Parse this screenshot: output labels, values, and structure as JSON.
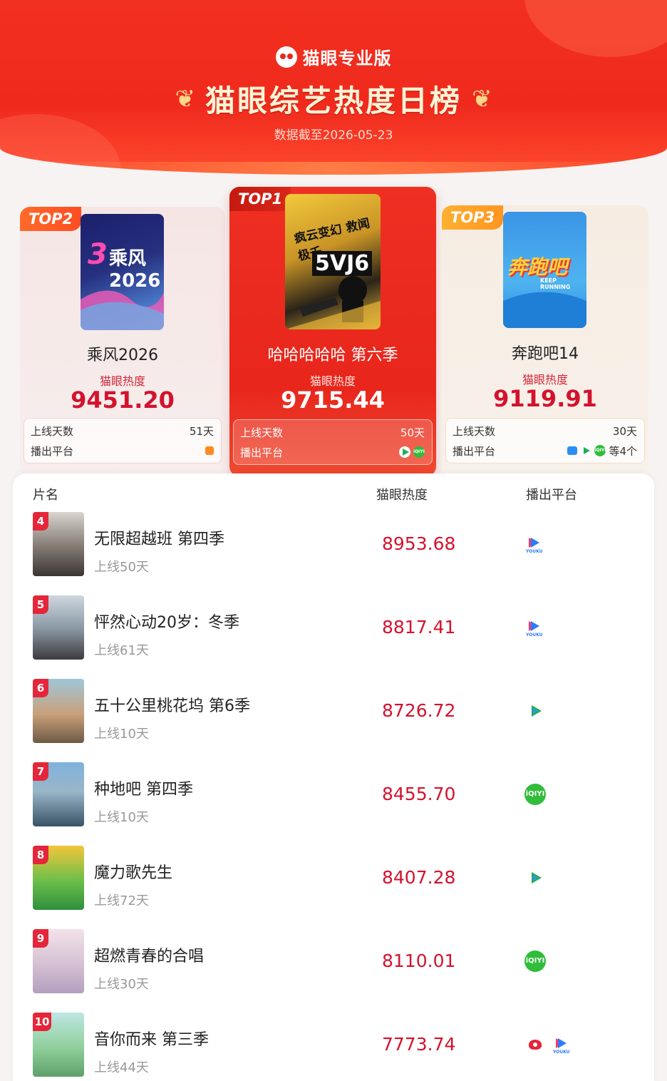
{
  "header": {
    "brand": "猫眼专业版",
    "title": "猫眼综艺热度日榜",
    "date": "数据截至2026-05-23"
  },
  "top3": [
    {
      "rank_label": "TOP2",
      "name": "乘风2026",
      "poster_text": "乘风2026",
      "heat_label": "猫眼热度",
      "heat": "9451.20",
      "days_label": "上线天数",
      "days": "51天",
      "platform_label": "播出平台",
      "platforms": [
        "mgtv-icon"
      ]
    },
    {
      "rank_label": "TOP1",
      "name": "哈哈哈哈哈 第六季",
      "poster_text": "疯云变幻 救闻极千",
      "poster_text2": "5VJ6",
      "heat_label": "猫眼热度",
      "heat": "9715.44",
      "days_label": "上线天数",
      "days": "50天",
      "platform_label": "播出平台",
      "platforms": [
        "tencent-video-icon",
        "iqiyi-icon"
      ]
    },
    {
      "rank_label": "TOP3",
      "name": "奔跑吧14",
      "poster_text": "奔跑吧",
      "poster_text2": "KEEP RUNNING",
      "heat_label": "猫眼热度",
      "heat": "9119.91",
      "days_label": "上线天数",
      "days": "30天",
      "platform_label": "播出平台",
      "platforms": [
        "blue-platform-icon",
        "tencent-video-icon",
        "iqiyi-icon"
      ],
      "platform_more": "等4个"
    }
  ],
  "list": {
    "headers": {
      "name": "片名",
      "heat": "猫眼热度",
      "platform": "播出平台"
    },
    "rows": [
      {
        "rank": "4",
        "title": "无限超越班 第四季",
        "days": "上线50天",
        "heat": "8953.68",
        "platforms": [
          "youku"
        ]
      },
      {
        "rank": "5",
        "title": "怦然心动20岁：冬季",
        "days": "上线61天",
        "heat": "8817.41",
        "platforms": [
          "youku"
        ]
      },
      {
        "rank": "6",
        "title": "五十公里桃花坞 第6季",
        "days": "上线10天",
        "heat": "8726.72",
        "platforms": [
          "tencent"
        ]
      },
      {
        "rank": "7",
        "title": "种地吧 第四季",
        "days": "上线10天",
        "heat": "8455.70",
        "platforms": [
          "iqiyi"
        ]
      },
      {
        "rank": "8",
        "title": "魔力歌先生",
        "days": "上线72天",
        "heat": "8407.28",
        "platforms": [
          "tencent"
        ]
      },
      {
        "rank": "9",
        "title": "超燃青春的合唱",
        "days": "上线30天",
        "heat": "8110.01",
        "platforms": [
          "iqiyi"
        ]
      },
      {
        "rank": "10",
        "title": "音你而来 第三季",
        "days": "上线44天",
        "heat": "7773.74",
        "platforms": [
          "mango",
          "youku"
        ]
      }
    ]
  },
  "colors": {
    "header_red": "#ef2a1d",
    "accent_red": "#d4122e",
    "top2_tag": "#ff5a26",
    "top3_tag": "#ffa227"
  }
}
